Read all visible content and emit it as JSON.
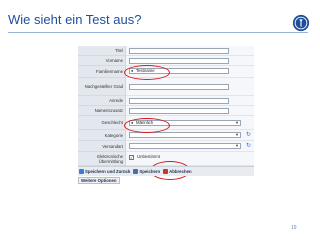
{
  "slide": {
    "title": "Wie sieht ein Test aus?",
    "page_number": "19"
  },
  "form": {
    "fields": [
      {
        "label": "Titel"
      },
      {
        "label": "Vorname"
      },
      {
        "label": "Familienname",
        "value": "Testname"
      },
      {
        "label": "Nachgestellter Grad"
      },
      {
        "label": "Anrede"
      },
      {
        "label": "Namenszusatz"
      },
      {
        "label": "Geschlecht",
        "value": "Männlich"
      },
      {
        "label": "Kategorie"
      },
      {
        "label": "Versandart"
      },
      {
        "label": "Elektronische Übermittlung",
        "value": "Unbestimmt"
      }
    ],
    "buttons": {
      "save_back": "Speichern und Zurück",
      "save": "Speichern",
      "cancel": "Abbrechen",
      "more_options": "Weitere Optionen"
    }
  },
  "colors": {
    "title": "#1f4e9c",
    "highlight": "#d21c1c"
  }
}
